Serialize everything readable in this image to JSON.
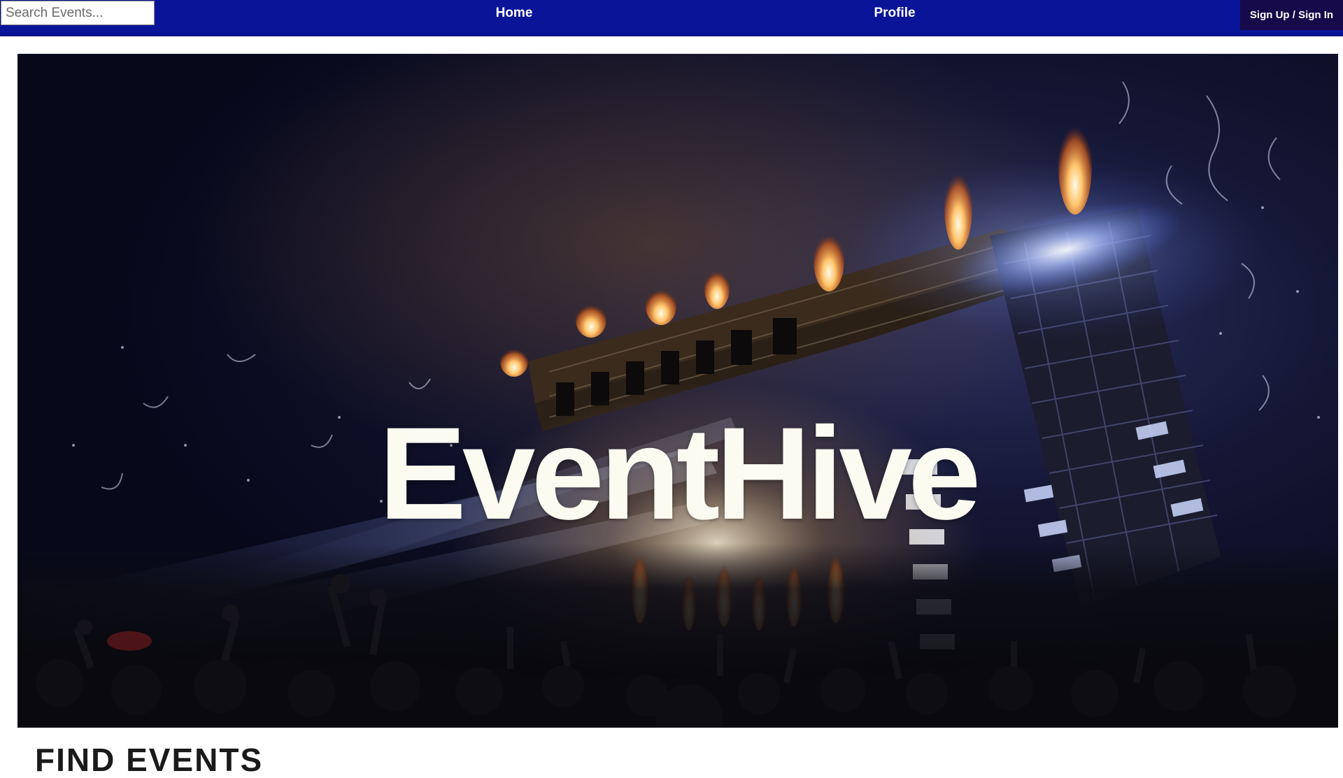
{
  "navbar": {
    "search_placeholder": "Search Events...",
    "links": [
      {
        "label": "Home"
      },
      {
        "label": "Profile"
      }
    ],
    "signin_label": "Sign Up / Sign In",
    "bg_color": "#0a1499",
    "signin_bg_color": "#160a4a"
  },
  "hero": {
    "title": "EventHive",
    "image_icon": "concert-stage-photo"
  },
  "section": {
    "heading": "FIND EVENTS"
  }
}
